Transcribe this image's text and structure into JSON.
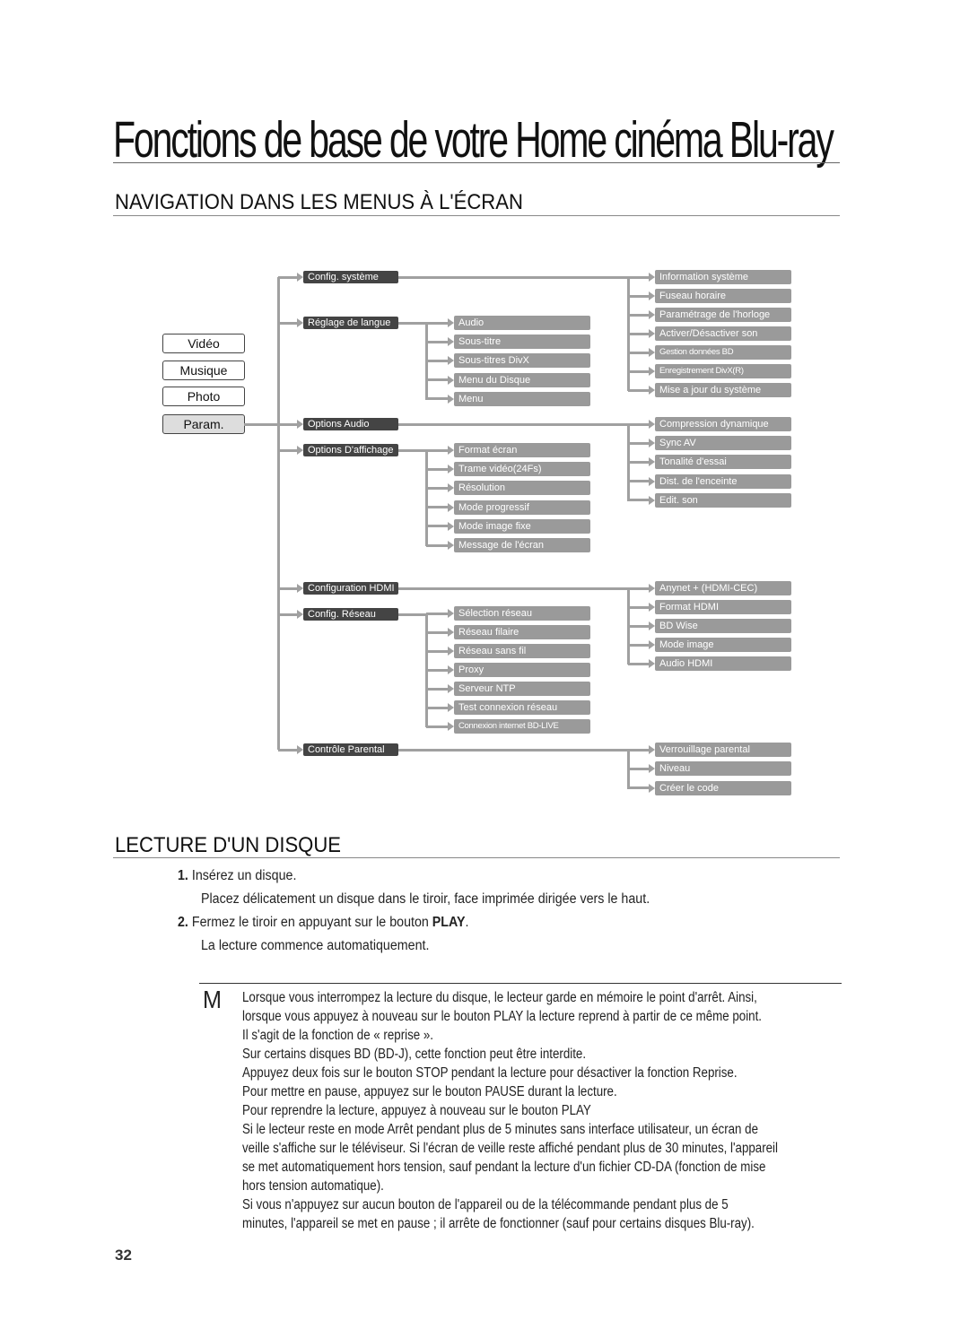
{
  "chapter_title": "Fonctions de base de votre Home cinéma Blu-ray",
  "section1": {
    "title": "NAVIGATION DANS LES MENUS À L'ÉCRAN"
  },
  "menu_diagram": {
    "modes": [
      "Vidéo",
      "Musique",
      "Photo",
      "Param."
    ],
    "active_mode": "Param.",
    "settings": [
      {
        "label": "Config. système",
        "children": [
          "Information système",
          "Fuseau horaire",
          "Paramétrage de l'horloge",
          "Activer/Désactiver son",
          "Gestion données BD",
          "Enregistrement DivX(R)",
          "Mise a jour du système"
        ]
      },
      {
        "label": "Réglage de langue",
        "children": [
          "Audio",
          "Sous-titre",
          "Sous-titres DivX",
          "Menu du Disque",
          "Menu"
        ]
      },
      {
        "label": "Options Audio",
        "children": [
          "Compression dynamique",
          "Sync AV",
          "Tonalité d'essai",
          "Dist. de l'enceinte",
          "Edit. son"
        ]
      },
      {
        "label": "Options D'affichage",
        "children": [
          "Format écran",
          "Trame vidéo(24Fs)",
          "Résolution",
          "Mode progressif",
          "Mode image fixe",
          "Message de l'écran"
        ]
      },
      {
        "label": "Configuration HDMI",
        "children": [
          "Anynet + (HDMI-CEC)",
          "Format HDMI",
          "BD Wise",
          "Mode image",
          "Audio HDMI"
        ]
      },
      {
        "label": "Config. Réseau",
        "children": [
          "Sélection réseau",
          "Réseau filaire",
          "Réseau sans fil",
          "Proxy",
          "Serveur NTP",
          "Test connexion réseau",
          "Connexion internet BD-LIVE"
        ]
      },
      {
        "label": "Contrôle Parental",
        "children": [
          "Verrouillage parental",
          "Niveau",
          "Créer le code"
        ]
      }
    ]
  },
  "section2": {
    "title": "LECTURE D'UN DISQUE",
    "steps": [
      {
        "num": "1.",
        "text": "Insérez un disque.",
        "sub": "Placez délicatement un disque dans le tiroir, face imprimée dirigée vers le haut."
      },
      {
        "num": "2.",
        "text_before": "Fermez le tiroir en appuyant sur le bouton ",
        "button": "PLAY",
        "text_after": ".",
        "sub": "La lecture commence automatiquement."
      }
    ]
  },
  "note": {
    "icon": "M",
    "lines": [
      "Lorsque vous interrompez la lecture du disque, le lecteur garde en mémoire le point d'arrêt. Ainsi,",
      "lorsque vous appuyez à nouveau sur le bouton PLAY la lecture reprend à partir de ce même point.",
      "Il s'agit de la fonction de « reprise ».",
      "Sur certains disques BD (BD-J), cette fonction peut être interdite.",
      "Appuyez deux fois sur le bouton STOP pendant la lecture pour désactiver la fonction Reprise.",
      "Pour mettre en pause, appuyez sur le bouton PAUSE durant la lecture.",
      "Pour reprendre la lecture, appuyez à nouveau sur le bouton PLAY",
      "Si le lecteur reste en mode Arrêt pendant plus de 5 minutes sans interface utilisateur, un écran de",
      "veille s'affiche sur le téléviseur. Si l'écran de veille reste affiché pendant plus de 30 minutes, l'appareil",
      "se met automatiquement hors tension, sauf pendant la lecture d'un fichier CD-DA (fonction de mise",
      "hors tension automatique).",
      "Si vous n'appuyez sur aucun bouton de l'appareil ou de la télécommande pendant plus de 5",
      "minutes, l'appareil se met en pause ; il arrête de fonctionner (sauf pour certains disques Blu-ray)."
    ]
  },
  "page_number": "32",
  "colors": {
    "dark_box": "#444444",
    "grey_box": "#9a9a9a",
    "connector": "#a0a0a0"
  }
}
